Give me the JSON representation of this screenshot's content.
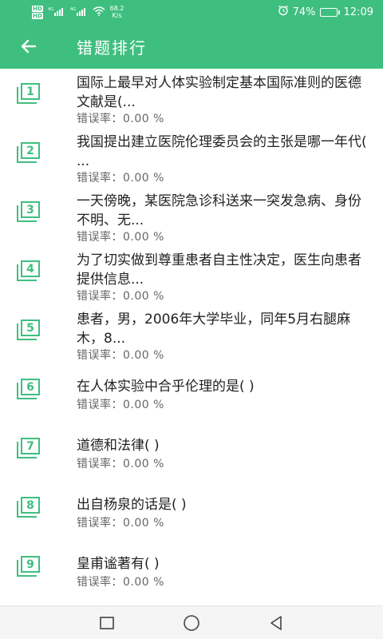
{
  "status_bar": {
    "hd1": "HD",
    "hd2": "HD",
    "signal1": "4G",
    "signal2": "4G",
    "net_speed": "68.2",
    "net_unit": "K/s",
    "battery": "74%",
    "battery_level": 0.74,
    "time": "12:09"
  },
  "app_bar": {
    "title": "错题排行",
    "back_icon": "arrow-left-icon"
  },
  "items": [
    {
      "num": "1",
      "text": "国际上最早对人体实验制定基本国际准则的医德文献是(...",
      "rate": "错误率：0.00 %"
    },
    {
      "num": "2",
      "text": "我国提出建立医院伦理委员会的主张是哪一年代(   ...",
      "rate": "错误率：0.00 %"
    },
    {
      "num": "3",
      "text": "一天傍晚，某医院急诊科送来一突发急病、身份不明、无...",
      "rate": "错误率：0.00 %"
    },
    {
      "num": "4",
      "text": "为了切实做到尊重患者自主性决定，医生向患者提供信息...",
      "rate": "错误率：0.00 %"
    },
    {
      "num": "5",
      "text": "患者，男，2006年大学毕业，同年5月右腿麻木，8...",
      "rate": "错误率：0.00 %"
    },
    {
      "num": "6",
      "text": "在人体实验中合乎伦理的是(    )",
      "rate": "错误率：0.00 %"
    },
    {
      "num": "7",
      "text": "道德和法律(    )",
      "rate": "错误率：0.00 %"
    },
    {
      "num": "8",
      "text": "出自杨泉的话是(    )",
      "rate": "错误率：0.00 %"
    },
    {
      "num": "9",
      "text": "皇甫谧著有(    )",
      "rate": "错误率：0.00 %"
    }
  ],
  "nav_bar": {
    "recent_icon": "square-icon",
    "home_icon": "circle-icon",
    "back_icon": "triangle-back-icon"
  },
  "colors": {
    "accent": "#3fbf7f",
    "text": "#222222",
    "subtext": "#666666"
  }
}
